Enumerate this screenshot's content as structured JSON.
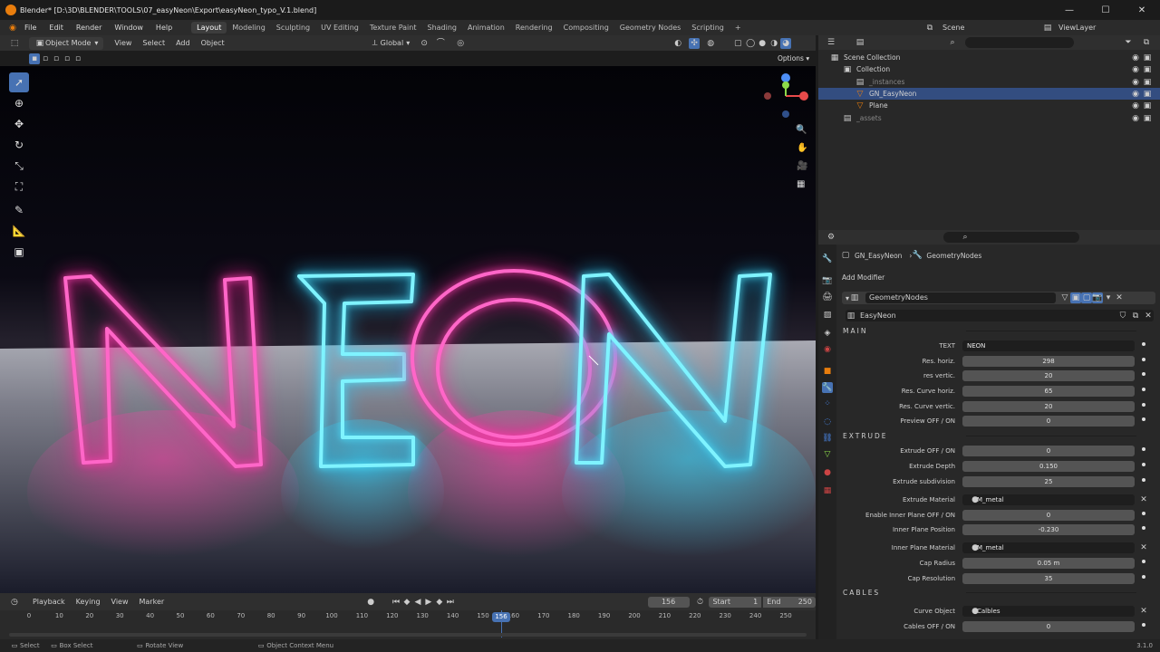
{
  "window": {
    "title": "Blender* [D:\\3D\\BLENDER\\TOOLS\\07_easyNeon\\Export\\easyNeon_typo_V.1.blend]",
    "minimize": "—",
    "maximize": "☐",
    "close": "✕"
  },
  "menubar": {
    "items": [
      "File",
      "Edit",
      "Render",
      "Window",
      "Help"
    ],
    "workspaces": [
      "Layout",
      "Modeling",
      "Sculpting",
      "UV Editing",
      "Texture Paint",
      "Shading",
      "Animation",
      "Rendering",
      "Compositing",
      "Geometry Nodes",
      "Scripting"
    ],
    "active_workspace": "Layout",
    "add_workspace": "+",
    "scene_label": "Scene",
    "viewlayer_label": "ViewLayer"
  },
  "viewport": {
    "mode": "Object Mode",
    "menus": [
      "View",
      "Select",
      "Add",
      "Object"
    ],
    "orientation": "Global",
    "options_label": "Options",
    "neon_text": "NEON"
  },
  "timeline": {
    "menus": [
      "Playback",
      "Keying",
      "View",
      "Marker"
    ],
    "current_frame": "156",
    "start_label": "Start",
    "start_value": "1",
    "end_label": "End",
    "end_value": "250",
    "ticks": [
      "0",
      "10",
      "20",
      "30",
      "40",
      "50",
      "60",
      "70",
      "80",
      "90",
      "100",
      "110",
      "120",
      "130",
      "140",
      "150",
      "160",
      "170",
      "180",
      "190",
      "200",
      "210",
      "220",
      "230",
      "240",
      "250"
    ],
    "playhead_label": "156"
  },
  "statusbar": {
    "select": "Select",
    "box_select": "Box Select",
    "rotate_view": "Rotate View",
    "context_menu": "Object Context Menu",
    "version": "3.1.0"
  },
  "outliner": {
    "rows": [
      {
        "label": "Scene Collection",
        "indent": 0
      },
      {
        "label": "Collection",
        "indent": 1
      },
      {
        "label": "_instances",
        "indent": 2
      },
      {
        "label": "GN_EasyNeon",
        "indent": 2,
        "selected": true
      },
      {
        "label": "Plane",
        "indent": 2
      },
      {
        "label": "_assets",
        "indent": 1
      }
    ]
  },
  "properties": {
    "breadcrumb_object": "GN_EasyNeon",
    "breadcrumb_modifier": "GeometryNodes",
    "add_modifier": "Add Modifier",
    "modifier_name": "GeometryNodes",
    "node_group": "EasyNeon",
    "sections": {
      "main": "MAIN",
      "extrude": "EXTRUDE",
      "cables": "CABLES"
    },
    "main_rows": [
      {
        "label": "TEXT",
        "value": "NEON",
        "kind": "text"
      },
      {
        "label": "Res. horiz.",
        "value": "298",
        "kind": "num"
      },
      {
        "label": "res vertic.",
        "value": "20",
        "kind": "num"
      },
      {
        "label": "Res. Curve horiz.",
        "value": "65",
        "kind": "num"
      },
      {
        "label": "Res. Curve vertic.",
        "value": "20",
        "kind": "num"
      },
      {
        "label": "Preview OFF / ON",
        "value": "0",
        "kind": "num"
      }
    ],
    "extrude_rows": [
      {
        "label": "Extrude OFF / ON",
        "value": "0",
        "kind": "num"
      },
      {
        "label": "Extrude Depth",
        "value": "0.150",
        "kind": "num"
      },
      {
        "label": "Extrude subdivision",
        "value": "25",
        "kind": "num"
      },
      {
        "label": "Extrude Material",
        "value": "M_metal",
        "kind": "mat"
      },
      {
        "label": "Enable Inner Plane OFF / ON",
        "value": "0",
        "kind": "num"
      },
      {
        "label": "Inner Plane Position",
        "value": "-0.230",
        "kind": "num"
      },
      {
        "label": "Inner Plane Material",
        "value": "M_metal",
        "kind": "mat"
      },
      {
        "label": "Cap Radius",
        "value": "0.05 m",
        "kind": "num"
      },
      {
        "label": "Cap Resolution",
        "value": "35",
        "kind": "num"
      }
    ],
    "cables_rows": [
      {
        "label": "Curve Object",
        "value": "Calbles",
        "kind": "mat"
      },
      {
        "label": "Cables OFF / ON",
        "value": "0",
        "kind": "num"
      }
    ]
  },
  "colors": {
    "accent": "#4772b3",
    "neon_pink": "#ff4fc0",
    "neon_cyan": "#5ff0ff",
    "blender_orange": "#e87d0d"
  }
}
